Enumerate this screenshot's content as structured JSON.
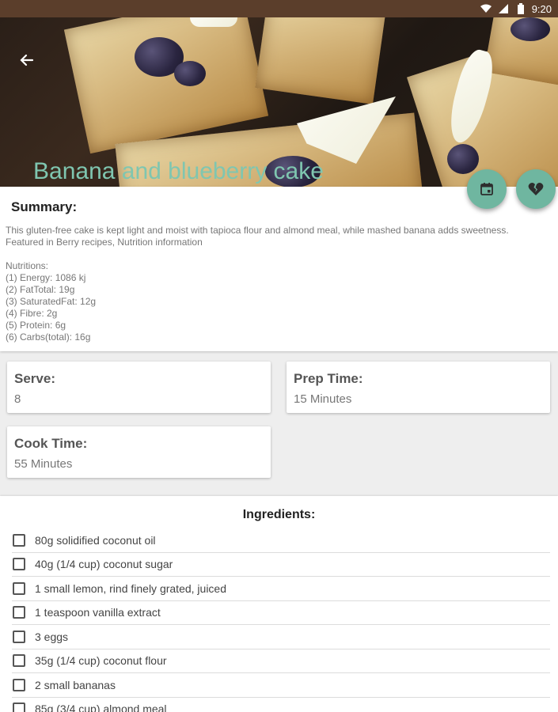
{
  "status_bar": {
    "time": "9:20",
    "icons": [
      "wifi-icon",
      "signal-icon",
      "battery-icon"
    ]
  },
  "header": {
    "title": "Banana and blueberry cake",
    "back_icon": "arrow-left-icon"
  },
  "actions": {
    "calendar_icon": "calendar-icon",
    "favorite_icon": "broken-heart-icon",
    "accent_color": "#6fb6a0"
  },
  "summary": {
    "title": "Summary:",
    "text": "This gluten-free cake is kept light and moist with tapioca flour and almond meal, while mashed banana adds sweetness. Featured in Berry recipes, Nutrition information",
    "nutritions_label": "Nutritions:",
    "nutritions": [
      "(1) Energy: 1086 kj",
      "(2) FatTotal: 19g",
      "(3) SaturatedFat: 12g",
      "(4) Fibre: 2g",
      "(5) Protein: 6g",
      "(6) Carbs(total): 16g"
    ]
  },
  "info": {
    "serve_label": "Serve:",
    "serve_value": "8",
    "prep_label": "Prep Time:",
    "prep_value": "15 Minutes",
    "cook_label": "Cook Time:",
    "cook_value": "55 Minutes"
  },
  "ingredients": {
    "title": "Ingredients:",
    "items": [
      "80g solidified coconut oil",
      "40g (1/4 cup) coconut sugar",
      "1 small lemon, rind finely grated, juiced",
      "1 teaspoon vanilla extract",
      "3 eggs",
      "35g (1/4 cup) coconut flour",
      "2 small bananas",
      "85g (3/4 cup) almond meal"
    ]
  }
}
